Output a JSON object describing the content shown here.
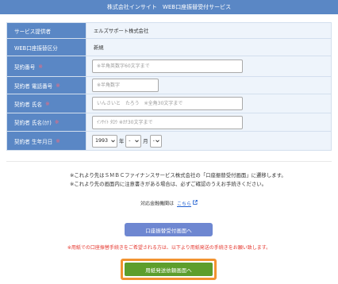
{
  "header": {
    "title": "株式会社インサイト　WEB口座振替受付サービス"
  },
  "info": {
    "provider": {
      "label": "サービス提供者",
      "value": "エルズサポート株式会社"
    },
    "transfer_type": {
      "label": "WEB口座振替区分",
      "value": "新規"
    }
  },
  "fields": {
    "contract_number": {
      "label": "契約番号",
      "required_mark": "※",
      "placeholder": "※半角英数字60文字まで"
    },
    "phone": {
      "label": "契約者 電話番号",
      "required_mark": "※",
      "placeholder": "※半角数字"
    },
    "name": {
      "label": "契約者 氏名",
      "required_mark": "※",
      "placeholder": "いんさいと　たろう　※全角30文字まで"
    },
    "name_kana": {
      "label": "契約者 氏名(ｶﾅ)",
      "required_mark": "※",
      "placeholder": "ｲﾝｻｲﾄ ﾀﾛｳ ※ｶﾅ30文字まで"
    },
    "birthdate": {
      "label": "契約者 生年月日",
      "required_mark": "※",
      "year": "1993",
      "year_unit": "年",
      "month": "-",
      "month_unit": "月",
      "day": "-"
    }
  },
  "notes": {
    "line1": "※これより先はＳＭＢＣファイナンスサービス株式会社の「口座振替受付画面」に遷移します。",
    "line2": "※これより先の画面内に注意書きがある場合は、必ずご確認のうえお手続きください。",
    "institutions_prefix": "対応金融機関は",
    "institutions_link": "こちら"
  },
  "actions": {
    "online_button": "口座振替受付画面へ",
    "paper_note": "※用紙での口座振替手続きをご希望される方は、以下より用紙発送の手続きをお願い致します。",
    "paper_button": "用紙発送依頼画面へ"
  },
  "icons": {
    "institutions_link": "external-link-icon",
    "select_arrow": "chevron-down-icon"
  },
  "colors": {
    "brand": "#5a87c5",
    "cell": "#eef4fb",
    "required": "#f26b7c",
    "button_blue": "#6e87d1",
    "button_green": "#5d9e2c",
    "highlight": "#f29330",
    "alert": "#e5362d",
    "link": "#1f5fd1"
  }
}
